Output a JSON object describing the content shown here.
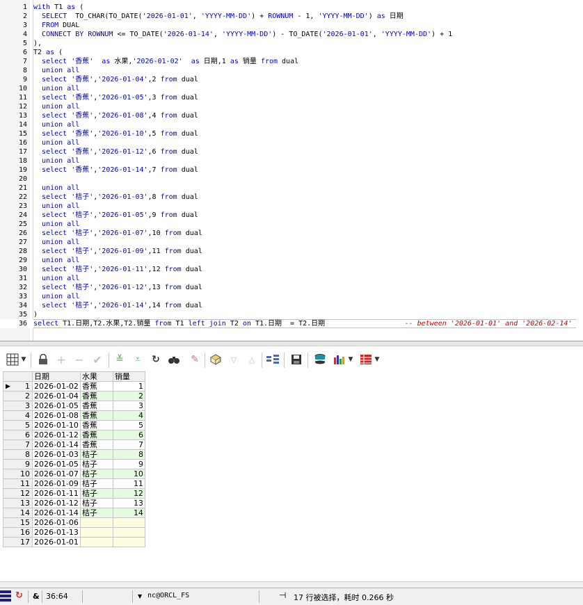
{
  "editor": {
    "lines": [
      {
        "n": "1",
        "html": "<span class='kw'>with</span> T1 <span class='kw'>as</span> ("
      },
      {
        "n": "2",
        "html": "  <span class='kw'>SELECT</span>  TO_CHAR(TO_DATE(<span class='str'>'2026-01-01'</span>, <span class='str'>'YYYY-MM-DD'</span>) + <span class='kw'>ROWNUM</span> - 1, <span class='str'>'YYYY-MM-DD'</span>) <span class='kw'>as</span> 日期"
      },
      {
        "n": "3",
        "html": "  <span class='kw'>FROM</span> DUAL"
      },
      {
        "n": "4",
        "html": "  <span class='kw'>CONNECT</span> <span class='kw'>BY</span> <span class='kw'>ROWNUM</span> &lt;= TO_DATE(<span class='str'>'2026-01-14'</span>, <span class='str'>'YYYY-MM-DD'</span>) - TO_DATE(<span class='str'>'2026-01-01'</span>, <span class='str'>'YYYY-MM-DD'</span>) + 1"
      },
      {
        "n": "5",
        "html": "),"
      },
      {
        "n": "6",
        "html": "T2 <span class='kw'>as</span> ("
      },
      {
        "n": "7",
        "html": "  <span class='kw'>select</span> <span class='str'>'香蕉'</span>  <span class='kw'>as</span> 水果,<span class='str'>'2026-01-02'</span>  <span class='kw'>as</span> 日期,1 <span class='kw'>as</span> 销量 <span class='kw'>from</span> dual"
      },
      {
        "n": "8",
        "html": "  <span class='kw'>union</span> <span class='kw'>all</span>"
      },
      {
        "n": "9",
        "html": "  <span class='kw'>select</span> <span class='str'>'香蕉'</span>,<span class='str'>'2026-01-04'</span>,2 <span class='kw'>from</span> dual"
      },
      {
        "n": "10",
        "html": "  <span class='kw'>union</span> <span class='kw'>all</span>"
      },
      {
        "n": "11",
        "html": "  <span class='kw'>select</span> <span class='str'>'香蕉'</span>,<span class='str'>'2026-01-05'</span>,3 <span class='kw'>from</span> dual"
      },
      {
        "n": "12",
        "html": "  <span class='kw'>union</span> <span class='kw'>all</span>"
      },
      {
        "n": "13",
        "html": "  <span class='kw'>select</span> <span class='str'>'香蕉'</span>,<span class='str'>'2026-01-08'</span>,4 <span class='kw'>from</span> dual"
      },
      {
        "n": "14",
        "html": "  <span class='kw'>union</span> <span class='kw'>all</span>"
      },
      {
        "n": "15",
        "html": "  <span class='kw'>select</span> <span class='str'>'香蕉'</span>,<span class='str'>'2026-01-10'</span>,5 <span class='kw'>from</span> dual"
      },
      {
        "n": "16",
        "html": "  <span class='kw'>union</span> <span class='kw'>all</span>"
      },
      {
        "n": "17",
        "html": "  <span class='kw'>select</span> <span class='str'>'香蕉'</span>,<span class='str'>'2026-01-12'</span>,6 <span class='kw'>from</span> dual"
      },
      {
        "n": "18",
        "html": "  <span class='kw'>union</span> <span class='kw'>all</span>"
      },
      {
        "n": "19",
        "html": "  <span class='kw'>select</span> <span class='str'>'香蕉'</span>,<span class='str'>'2026-01-14'</span>,7 <span class='kw'>from</span> dual"
      },
      {
        "n": "20",
        "html": ""
      },
      {
        "n": "21",
        "html": "  <span class='kw'>union</span> <span class='kw'>all</span>"
      },
      {
        "n": "22",
        "html": "  <span class='kw'>select</span> <span class='str'>'桔子'</span>,<span class='str'>'2026-01-03'</span>,8 <span class='kw'>from</span> dual"
      },
      {
        "n": "23",
        "html": "  <span class='kw'>union</span> <span class='kw'>all</span>"
      },
      {
        "n": "24",
        "html": "  <span class='kw'>select</span> <span class='str'>'桔子'</span>,<span class='str'>'2026-01-05'</span>,9 <span class='kw'>from</span> dual"
      },
      {
        "n": "25",
        "html": "  <span class='kw'>union</span> <span class='kw'>all</span>"
      },
      {
        "n": "26",
        "html": "  <span class='kw'>select</span> <span class='str'>'桔子'</span>,<span class='str'>'2026-01-07'</span>,10 <span class='kw'>from</span> dual"
      },
      {
        "n": "27",
        "html": "  <span class='kw'>union</span> <span class='kw'>all</span>"
      },
      {
        "n": "28",
        "html": "  <span class='kw'>select</span> <span class='str'>'桔子'</span>,<span class='str'>'2026-01-09'</span>,11 <span class='kw'>from</span> dual"
      },
      {
        "n": "29",
        "html": "  <span class='kw'>union</span> <span class='kw'>all</span>"
      },
      {
        "n": "30",
        "html": "  <span class='kw'>select</span> <span class='str'>'桔子'</span>,<span class='str'>'2026-01-11'</span>,12 <span class='kw'>from</span> dual"
      },
      {
        "n": "31",
        "html": "  <span class='kw'>union</span> <span class='kw'>all</span>"
      },
      {
        "n": "32",
        "html": "  <span class='kw'>select</span> <span class='str'>'桔子'</span>,<span class='str'>'2026-01-12'</span>,13 <span class='kw'>from</span> dual"
      },
      {
        "n": "33",
        "html": "  <span class='kw'>union</span> <span class='kw'>all</span>"
      },
      {
        "n": "34",
        "html": "  <span class='kw'>select</span> <span class='str'>'桔子'</span>,<span class='str'>'2026-01-14'</span>,14 <span class='kw'>from</span> dual"
      },
      {
        "n": "35",
        "html": ")"
      },
      {
        "n": "36",
        "html": "<span class='kw'>select</span> T1.日期,T2.水果,T2.销量 <span class='kw'>from</span> T1 <span class='kw'>left</span> <span class='kw'>join</span> T2 <span class='kw'>on</span> T1.日期  = T2.日期                   <span class='cmt'>-- between '2026-01-01' and '2026-02-14'</span>"
      }
    ]
  },
  "toolbar": {
    "icons": [
      "grid-view-icon",
      "lock-icon",
      "add-record-icon",
      "delete-record-icon",
      "post-changes-icon",
      "fetch-next-icon",
      "fetch-last-icon",
      "refresh-icon",
      "find-icon",
      "clear-icon",
      "query-by-example-icon",
      "filter-icon",
      "sort-asc-icon",
      "sort-desc-icon",
      "export-icon",
      "save-icon",
      "print-icon",
      "chart-icon",
      "table-icon"
    ]
  },
  "grid": {
    "headers": [
      "日期",
      "水果",
      "销量"
    ],
    "rows": [
      {
        "n": "1",
        "date": "2026-01-02",
        "fruit": "香蕉",
        "qty": "1"
      },
      {
        "n": "2",
        "date": "2026-01-04",
        "fruit": "香蕉",
        "qty": "2"
      },
      {
        "n": "3",
        "date": "2026-01-05",
        "fruit": "香蕉",
        "qty": "3"
      },
      {
        "n": "4",
        "date": "2026-01-08",
        "fruit": "香蕉",
        "qty": "4"
      },
      {
        "n": "5",
        "date": "2026-01-10",
        "fruit": "香蕉",
        "qty": "5"
      },
      {
        "n": "6",
        "date": "2026-01-12",
        "fruit": "香蕉",
        "qty": "6"
      },
      {
        "n": "7",
        "date": "2026-01-14",
        "fruit": "香蕉",
        "qty": "7"
      },
      {
        "n": "8",
        "date": "2026-01-03",
        "fruit": "桔子",
        "qty": "8"
      },
      {
        "n": "9",
        "date": "2026-01-05",
        "fruit": "桔子",
        "qty": "9"
      },
      {
        "n": "10",
        "date": "2026-01-07",
        "fruit": "桔子",
        "qty": "10"
      },
      {
        "n": "11",
        "date": "2026-01-09",
        "fruit": "桔子",
        "qty": "11"
      },
      {
        "n": "12",
        "date": "2026-01-11",
        "fruit": "桔子",
        "qty": "12"
      },
      {
        "n": "13",
        "date": "2026-01-12",
        "fruit": "桔子",
        "qty": "13"
      },
      {
        "n": "14",
        "date": "2026-01-14",
        "fruit": "桔子",
        "qty": "14"
      },
      {
        "n": "15",
        "date": "2026-01-06",
        "fruit": "",
        "qty": ""
      },
      {
        "n": "16",
        "date": "2026-01-13",
        "fruit": "",
        "qty": ""
      },
      {
        "n": "17",
        "date": "2026-01-01",
        "fruit": "",
        "qty": ""
      }
    ]
  },
  "status": {
    "amp": "&",
    "cursor_pos": "36:64",
    "connection": "nc@ORCL_FS",
    "result_msg": "17 行被选择，耗时 0.266 秒"
  },
  "colors": {
    "keyword": "#0000c8",
    "comment": "#c80000",
    "row_even": "#e4fbe0",
    "row_null": "#fffde0"
  }
}
